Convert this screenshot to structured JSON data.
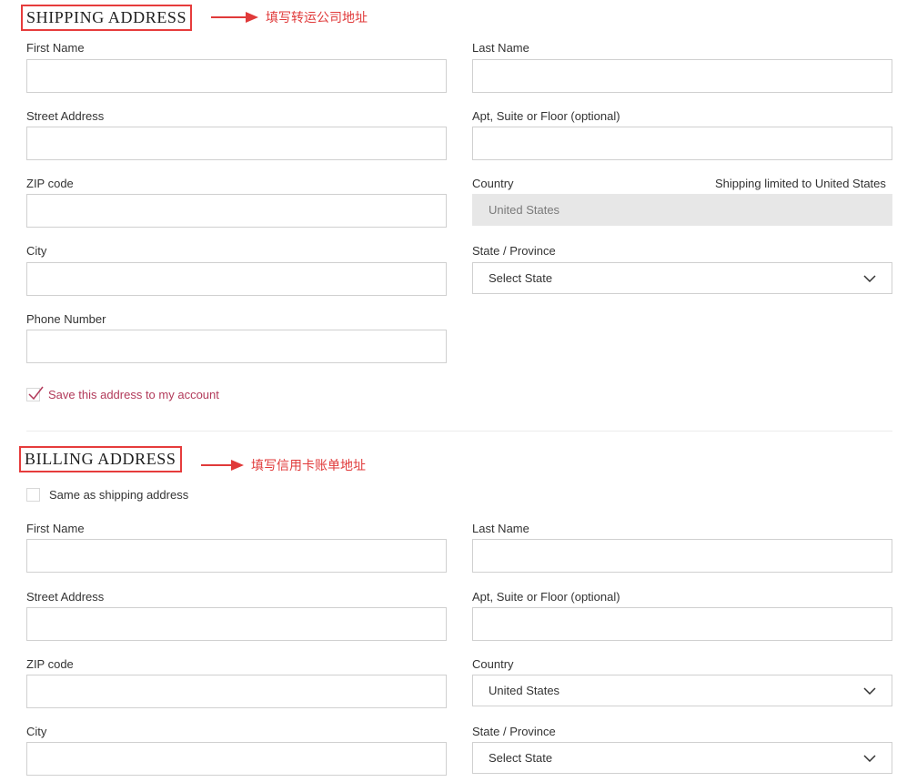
{
  "shipping": {
    "title": "SHIPPING ADDRESS",
    "annotation": "填写转运公司地址",
    "first_name_label": "First Name",
    "last_name_label": "Last Name",
    "street_label": "Street Address",
    "apt_label": "Apt, Suite or Floor (optional)",
    "zip_label": "ZIP code",
    "country_label": "Country",
    "country_note": "Shipping limited to United States",
    "country_value": "United States",
    "city_label": "City",
    "state_label": "State / Province",
    "state_value": "Select State",
    "phone_label": "Phone Number",
    "save_checkbox_label": "Save this address to my account",
    "save_checked": true
  },
  "billing": {
    "title": "BILLING ADDRESS",
    "annotation": "填写信用卡账单地址",
    "same_as_label": "Same as shipping address",
    "same_as_checked": false,
    "first_name_label": "First Name",
    "last_name_label": "Last Name",
    "street_label": "Street Address",
    "apt_label": "Apt, Suite or Floor (optional)",
    "zip_label": "ZIP code",
    "country_label": "Country",
    "country_value": "United States",
    "city_label": "City",
    "state_label": "State / Province",
    "state_value": "Select State"
  },
  "colors": {
    "annotation_red": "#e03a3a",
    "accent_checkbox": "#b23a5a",
    "border": "#d0d0d0",
    "disabled_bg": "#e7e7e7"
  }
}
